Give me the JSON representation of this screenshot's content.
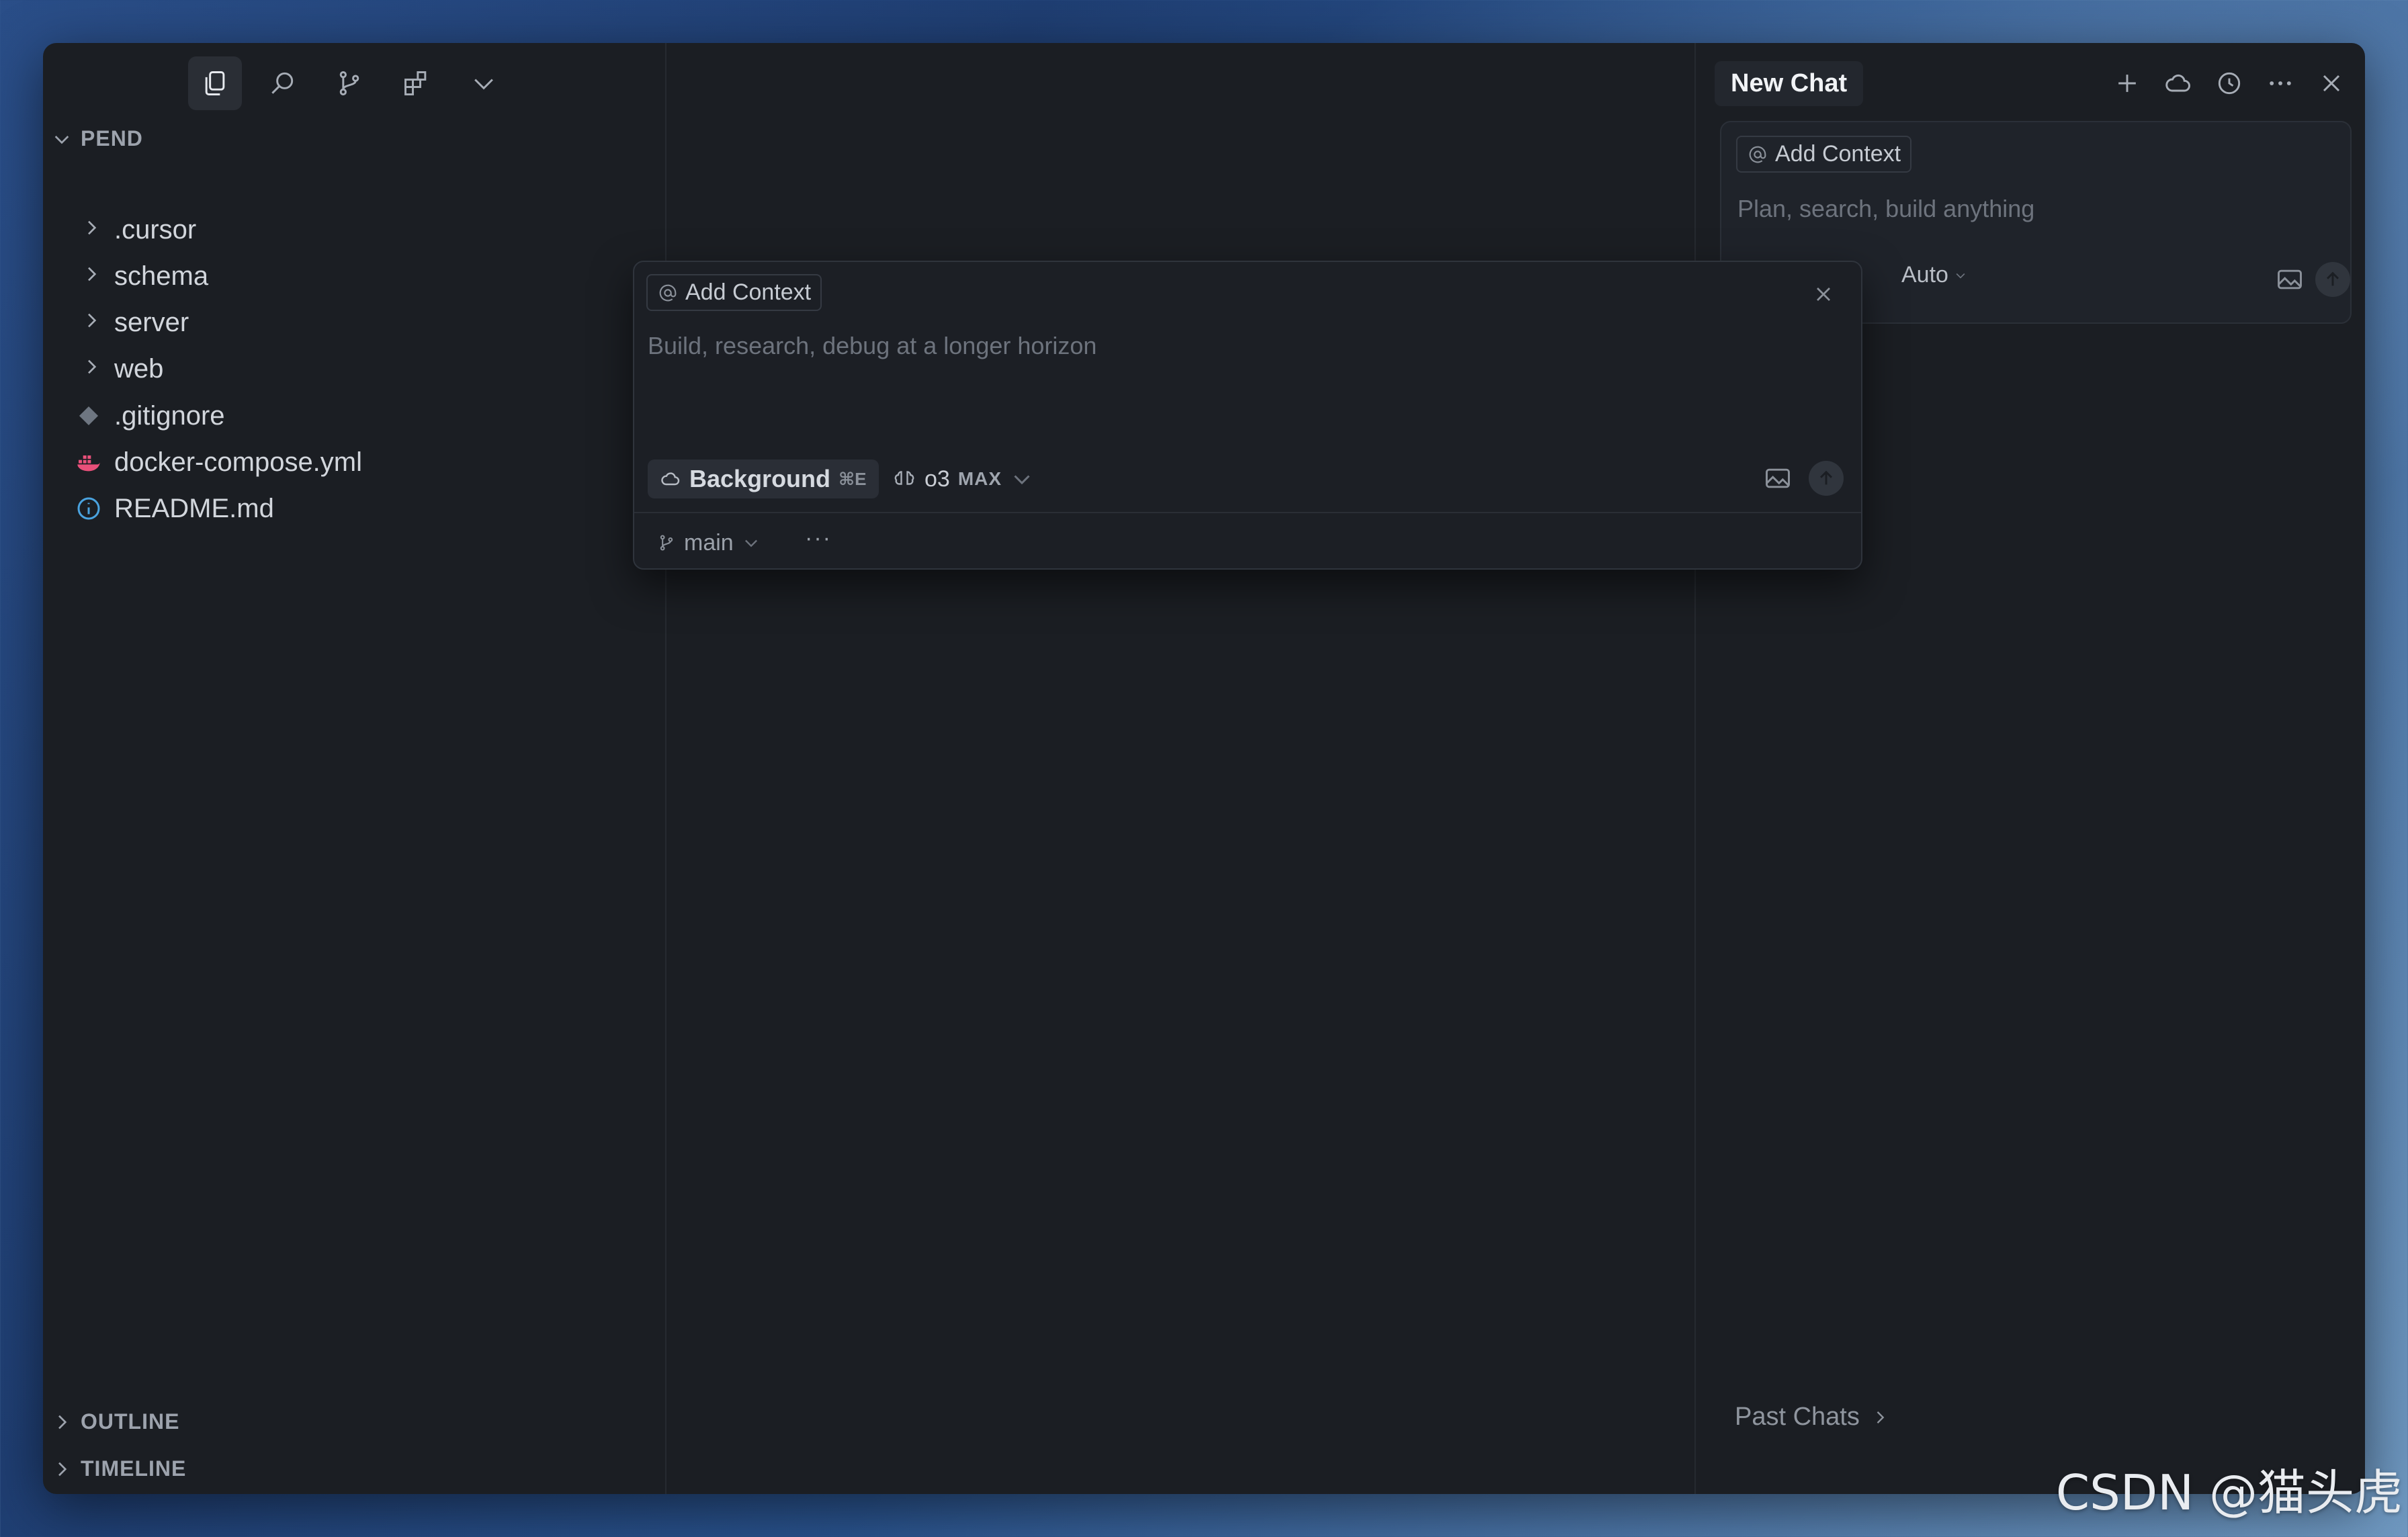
{
  "activity_bar": {
    "icons": [
      "files-icon",
      "search-icon",
      "source-control-icon",
      "extensions-icon",
      "chevron-down-icon"
    ]
  },
  "explorer": {
    "section_title": "PEND",
    "items": [
      {
        "label": ".cursor",
        "type": "folder"
      },
      {
        "label": "schema",
        "type": "folder"
      },
      {
        "label": "server",
        "type": "folder"
      },
      {
        "label": "web",
        "type": "folder"
      },
      {
        "label": ".gitignore",
        "type": "git-file",
        "icon": "git-icon"
      },
      {
        "label": "docker-compose.yml",
        "type": "file",
        "icon": "docker-icon"
      },
      {
        "label": "README.md",
        "type": "file",
        "icon": "info-icon"
      }
    ],
    "outline_label": "OUTLINE",
    "timeline_label": "TIMELINE"
  },
  "chat": {
    "tab_title": "New Chat",
    "add_context_label": "Add Context",
    "placeholder": "Plan, search, build anything",
    "mode_label": "Auto",
    "past_chats_label": "Past Chats"
  },
  "background_agent_popup": {
    "add_context_label": "Add Context",
    "placeholder": "Build, research, debug at a longer horizon",
    "mode_label": "Background",
    "mode_shortcut": "⌘E",
    "model_label": "o3",
    "model_badge": "MAX",
    "branch_label": "main",
    "more_label": "···"
  },
  "watermark": "CSDN @猫头虎",
  "colors": {
    "window_bg": "#1b1e23",
    "docker_icon": "#e9507a",
    "info_icon": "#4aa3df"
  }
}
